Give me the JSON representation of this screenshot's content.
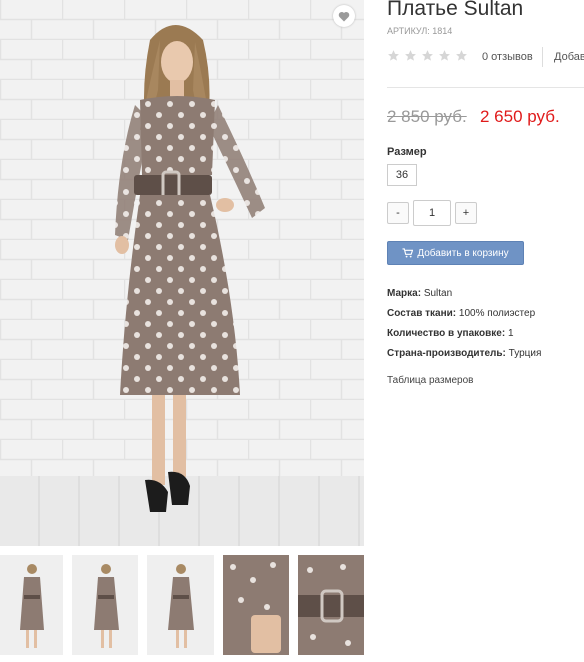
{
  "product": {
    "title": "Платье Sultan",
    "sku": "АРТИКУЛ: 1814",
    "reviews": "0 отзывов",
    "add_review": "Добав",
    "rating": 0,
    "rating_max": 5,
    "old_price": "2 850 руб.",
    "new_price": "2 650 руб.",
    "size_label": "Размер",
    "sizes": [
      "36"
    ],
    "qty_minus": "-",
    "qty_value": "1",
    "qty_plus": "+",
    "add_to_cart": "Добавить в корзину",
    "properties": [
      {
        "name": "Марка:",
        "value": "Sultan"
      },
      {
        "name": "Состав ткани:",
        "value": "100% полиэстер"
      },
      {
        "name": "Количество в упаковке:",
        "value": "1"
      },
      {
        "name": "Страна-производитель:",
        "value": "Турция"
      }
    ],
    "size_table_link": "Таблица размеров"
  },
  "icons": {
    "favorite": "heart-icon",
    "cart": "cart-icon",
    "star": "star-icon"
  },
  "colors": {
    "price_new": "#e01b1b",
    "button": "#6f93c5",
    "dress": "#8d7b72",
    "star_empty": "#d6d6d6"
  }
}
